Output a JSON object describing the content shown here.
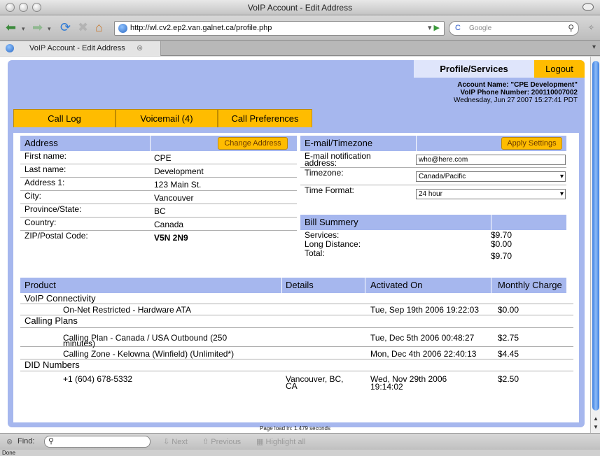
{
  "window": {
    "title": "VoIP Account - Edit Address"
  },
  "toolbar": {
    "url": "http://wl.cv2.ep2.van.galnet.ca/profile.php",
    "search_engine": "C",
    "search_placeholder": "Google"
  },
  "tab": {
    "label": "VoIP Account - Edit Address"
  },
  "header": {
    "profile_services": "Profile/Services",
    "logout": "Logout",
    "account_name": "Account Name: \"CPE Development\"",
    "voip_number": "VoIP Phone Number: 200110007002",
    "datetime": "Wednesday, Jun 27 2007 15:27:41 PDT"
  },
  "nav_tabs": [
    "Call Log",
    "Voicemail (4)",
    "Call Preferences"
  ],
  "address": {
    "title": "Address",
    "button": "Change Address",
    "rows": [
      {
        "label": "First name:",
        "value": "CPE"
      },
      {
        "label": "Last name:",
        "value": "Development"
      },
      {
        "label": "Address 1:",
        "value": "123 Main St."
      },
      {
        "label": "City:",
        "value": "Vancouver"
      },
      {
        "label": "Province/State:",
        "value": "BC"
      },
      {
        "label": "Country:",
        "value": "Canada"
      },
      {
        "label": "ZIP/Postal Code:",
        "value": "V5N 2N9"
      }
    ]
  },
  "email": {
    "title": "E-mail/Timezone",
    "button": "Apply Settings",
    "notif_label_1": "E-mail notification",
    "notif_label_2": "address:",
    "notif_value": "who@here.com",
    "timezone_label": "Timezone:",
    "timezone_value": "Canada/Pacific",
    "format_label": "Time Format:",
    "format_value": "24 hour"
  },
  "bill": {
    "title": "Bill Summery",
    "rows": [
      {
        "label": "Services:",
        "value": "$9.70"
      },
      {
        "label": "Long Distance:",
        "value": "$0.00"
      },
      {
        "label": "Total:",
        "value": "$9.70"
      }
    ]
  },
  "products": {
    "headers": [
      "Product",
      "Details",
      "Activated On",
      "Monthly Charge"
    ],
    "cat_voip": "VoIP Connectivity",
    "cat_calling": "Calling Plans",
    "cat_did": "DID Numbers",
    "items": [
      {
        "name": "On-Net Restricted - Hardware ATA",
        "details": "",
        "activated": "Tue, Sep 19th 2006 19:22:03",
        "charge": "$0.00"
      },
      {
        "name_1": "Calling Plan - Canada / USA Outbound (250",
        "name_2": "minutes)",
        "details": "",
        "activated": "Tue, Dec 5th 2006 00:48:27",
        "charge": "$2.75"
      },
      {
        "name": "Calling Zone - Kelowna (Winfield) (Unlimited*)",
        "details": "",
        "activated": "Mon, Dec 4th 2006 22:40:13",
        "charge": "$4.45"
      },
      {
        "name": "+1 (604) 678-5332",
        "details_1": "Vancouver, BC,",
        "details_2": "CA",
        "activated_1": "Wed, Nov 29th 2006",
        "activated_2": "19:14:02",
        "charge": "$2.50"
      }
    ]
  },
  "page_load": "Page load in: 1.479 seconds",
  "findbar": {
    "label": "Find:",
    "next": "Next",
    "previous": "Previous",
    "highlight": "Highlight all"
  },
  "status": "Done"
}
